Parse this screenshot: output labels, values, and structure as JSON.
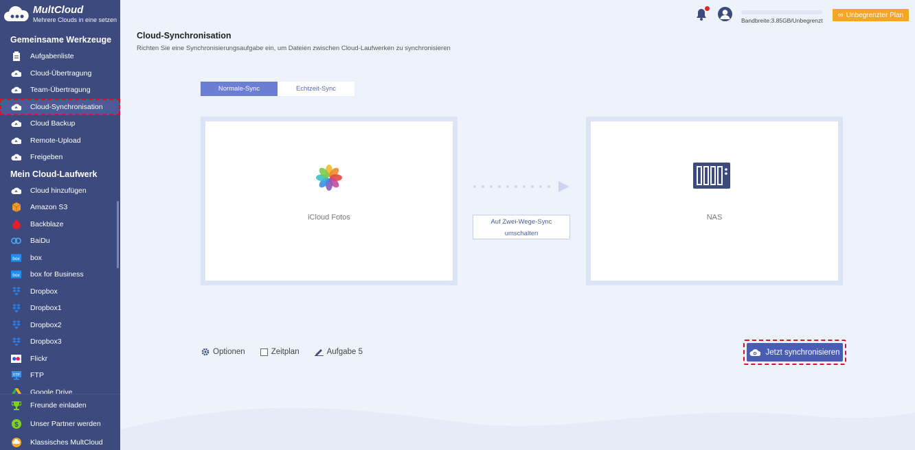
{
  "brand": {
    "name": "MultCloud",
    "tagline": "Mehrere Clouds in eine setzen"
  },
  "sidebar": {
    "section1": "Gemeinsame Werkzeuge",
    "tools": [
      {
        "label": "Aufgabenliste",
        "icon": "clipboard-icon"
      },
      {
        "label": "Cloud-Übertragung",
        "icon": "cloud-transfer-icon"
      },
      {
        "label": "Team-Übertragung",
        "icon": "team-transfer-icon"
      },
      {
        "label": "Cloud-Synchronisation",
        "icon": "cloud-sync-icon",
        "active": true
      },
      {
        "label": "Cloud Backup",
        "icon": "cloud-backup-icon"
      },
      {
        "label": "Remote-Upload",
        "icon": "remote-upload-icon"
      },
      {
        "label": "Freigeben",
        "icon": "share-icon"
      }
    ],
    "section2": "Mein Cloud-Laufwerk",
    "drives": [
      {
        "label": "Cloud hinzufügen",
        "icon": "cloud-add-icon"
      },
      {
        "label": "Amazon S3",
        "icon": "amazon-s3-icon"
      },
      {
        "label": "Backblaze",
        "icon": "backblaze-icon"
      },
      {
        "label": "BaiDu",
        "icon": "baidu-icon"
      },
      {
        "label": "box",
        "icon": "box-icon"
      },
      {
        "label": "box for Business",
        "icon": "box-business-icon"
      },
      {
        "label": "Dropbox",
        "icon": "dropbox-icon"
      },
      {
        "label": "Dropbox1",
        "icon": "dropbox-icon"
      },
      {
        "label": "Dropbox2",
        "icon": "dropbox-icon"
      },
      {
        "label": "Dropbox3",
        "icon": "dropbox-icon"
      },
      {
        "label": "Flickr",
        "icon": "flickr-icon"
      },
      {
        "label": "FTP",
        "icon": "ftp-icon"
      },
      {
        "label": "Google Drive",
        "icon": "google-drive-icon"
      }
    ],
    "bottom": [
      {
        "label": "Freunde einladen",
        "icon": "trophy-icon"
      },
      {
        "label": "Unser Partner werden",
        "icon": "dollar-icon"
      },
      {
        "label": "Klassisches MultCloud",
        "icon": "classic-icon"
      }
    ]
  },
  "header": {
    "bandwidth": "Bandbreite:3.85GB/Unbegrenzt",
    "plan_label": "Unbegrenzter Plan"
  },
  "page": {
    "title": "Cloud-Synchronisation",
    "subtitle": "Richten Sie eine Synchronisierungsaufgabe ein, um Dateien zwischen Cloud-Laufwerken zu synchronisieren"
  },
  "tabs": [
    {
      "label": "Normale-Sync",
      "selected": true
    },
    {
      "label": "Echtzeit-Sync",
      "selected": false
    }
  ],
  "source": {
    "label": "iCloud Fotos",
    "icon": "icloud-photos-icon"
  },
  "target": {
    "label": "NAS",
    "icon": "nas-icon"
  },
  "switch_label_1": "Auf Zwei-Wege-Sync",
  "switch_label_2": "umschalten",
  "options": {
    "options_label": "Optionen",
    "schedule_label": "Zeitplan",
    "task_label": "Aufgabe 5"
  },
  "sync_button": "Jetzt synchronisieren",
  "colors": {
    "sidebar": "#3d4a7d",
    "accent": "#4a5db5",
    "plan": "#f5a623",
    "highlight": "#d7112a"
  }
}
